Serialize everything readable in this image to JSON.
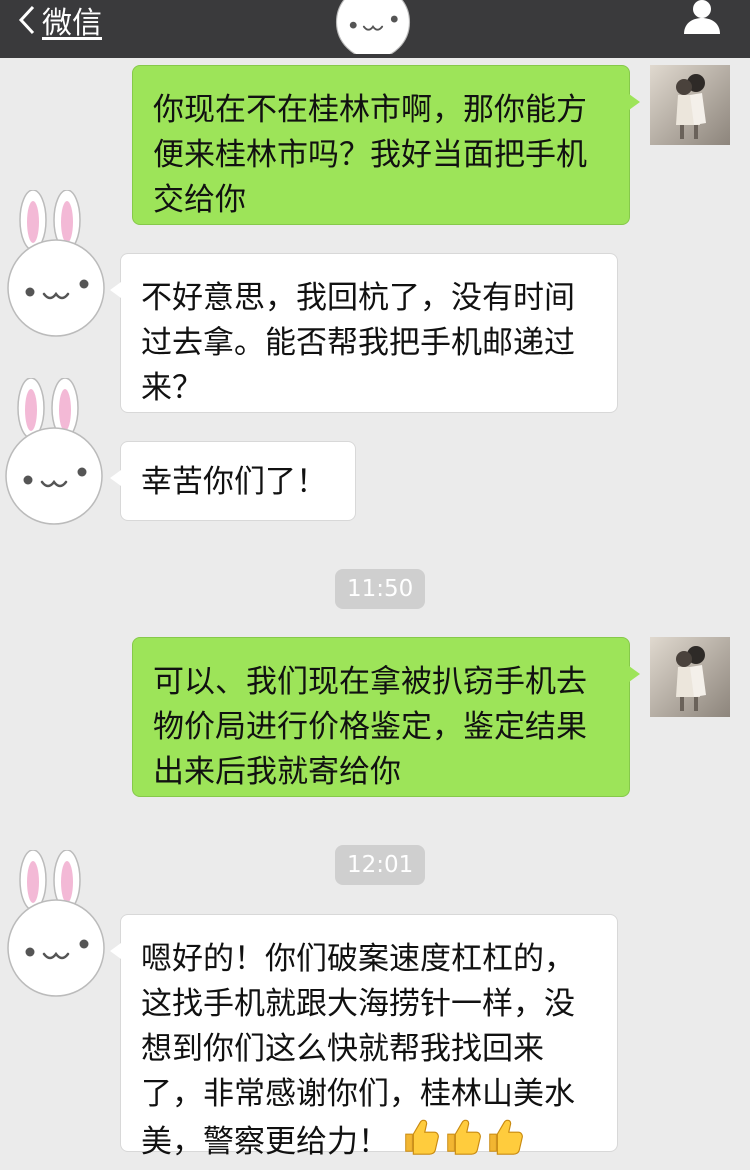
{
  "header": {
    "back_label": "微信"
  },
  "messages": [
    {
      "side": "sent",
      "text": "你现在不在桂林市啊，那你能方便来桂林市吗？我好当面把手机交给你"
    },
    {
      "side": "recv",
      "text": "不好意思，我回杭了，没有时间过去拿。能否帮我把手机邮递过来？"
    },
    {
      "side": "recv",
      "text": "幸苦你们了！"
    },
    {
      "side": "sent",
      "text": "可以、我们现在拿被扒窃手机去物价局进行价格鉴定，鉴定结果出来后我就寄给你"
    },
    {
      "side": "recv",
      "text": "嗯好的！你们破案速度杠杠的，这找手机就跟大海捞针一样，没想到你们这么快就帮我找回来了，非常感谢你们，桂林山美水美，警察更给力！"
    }
  ],
  "timestamps": [
    "11:50",
    "12:01"
  ],
  "colors": {
    "sent_bubble": "#9de459",
    "recv_bubble": "#ffffff",
    "background": "#ebebeb",
    "topbar": "#3a3a3c"
  },
  "icons": [
    "back-chevron-icon",
    "profile-icon",
    "thumbs-up-icon"
  ]
}
